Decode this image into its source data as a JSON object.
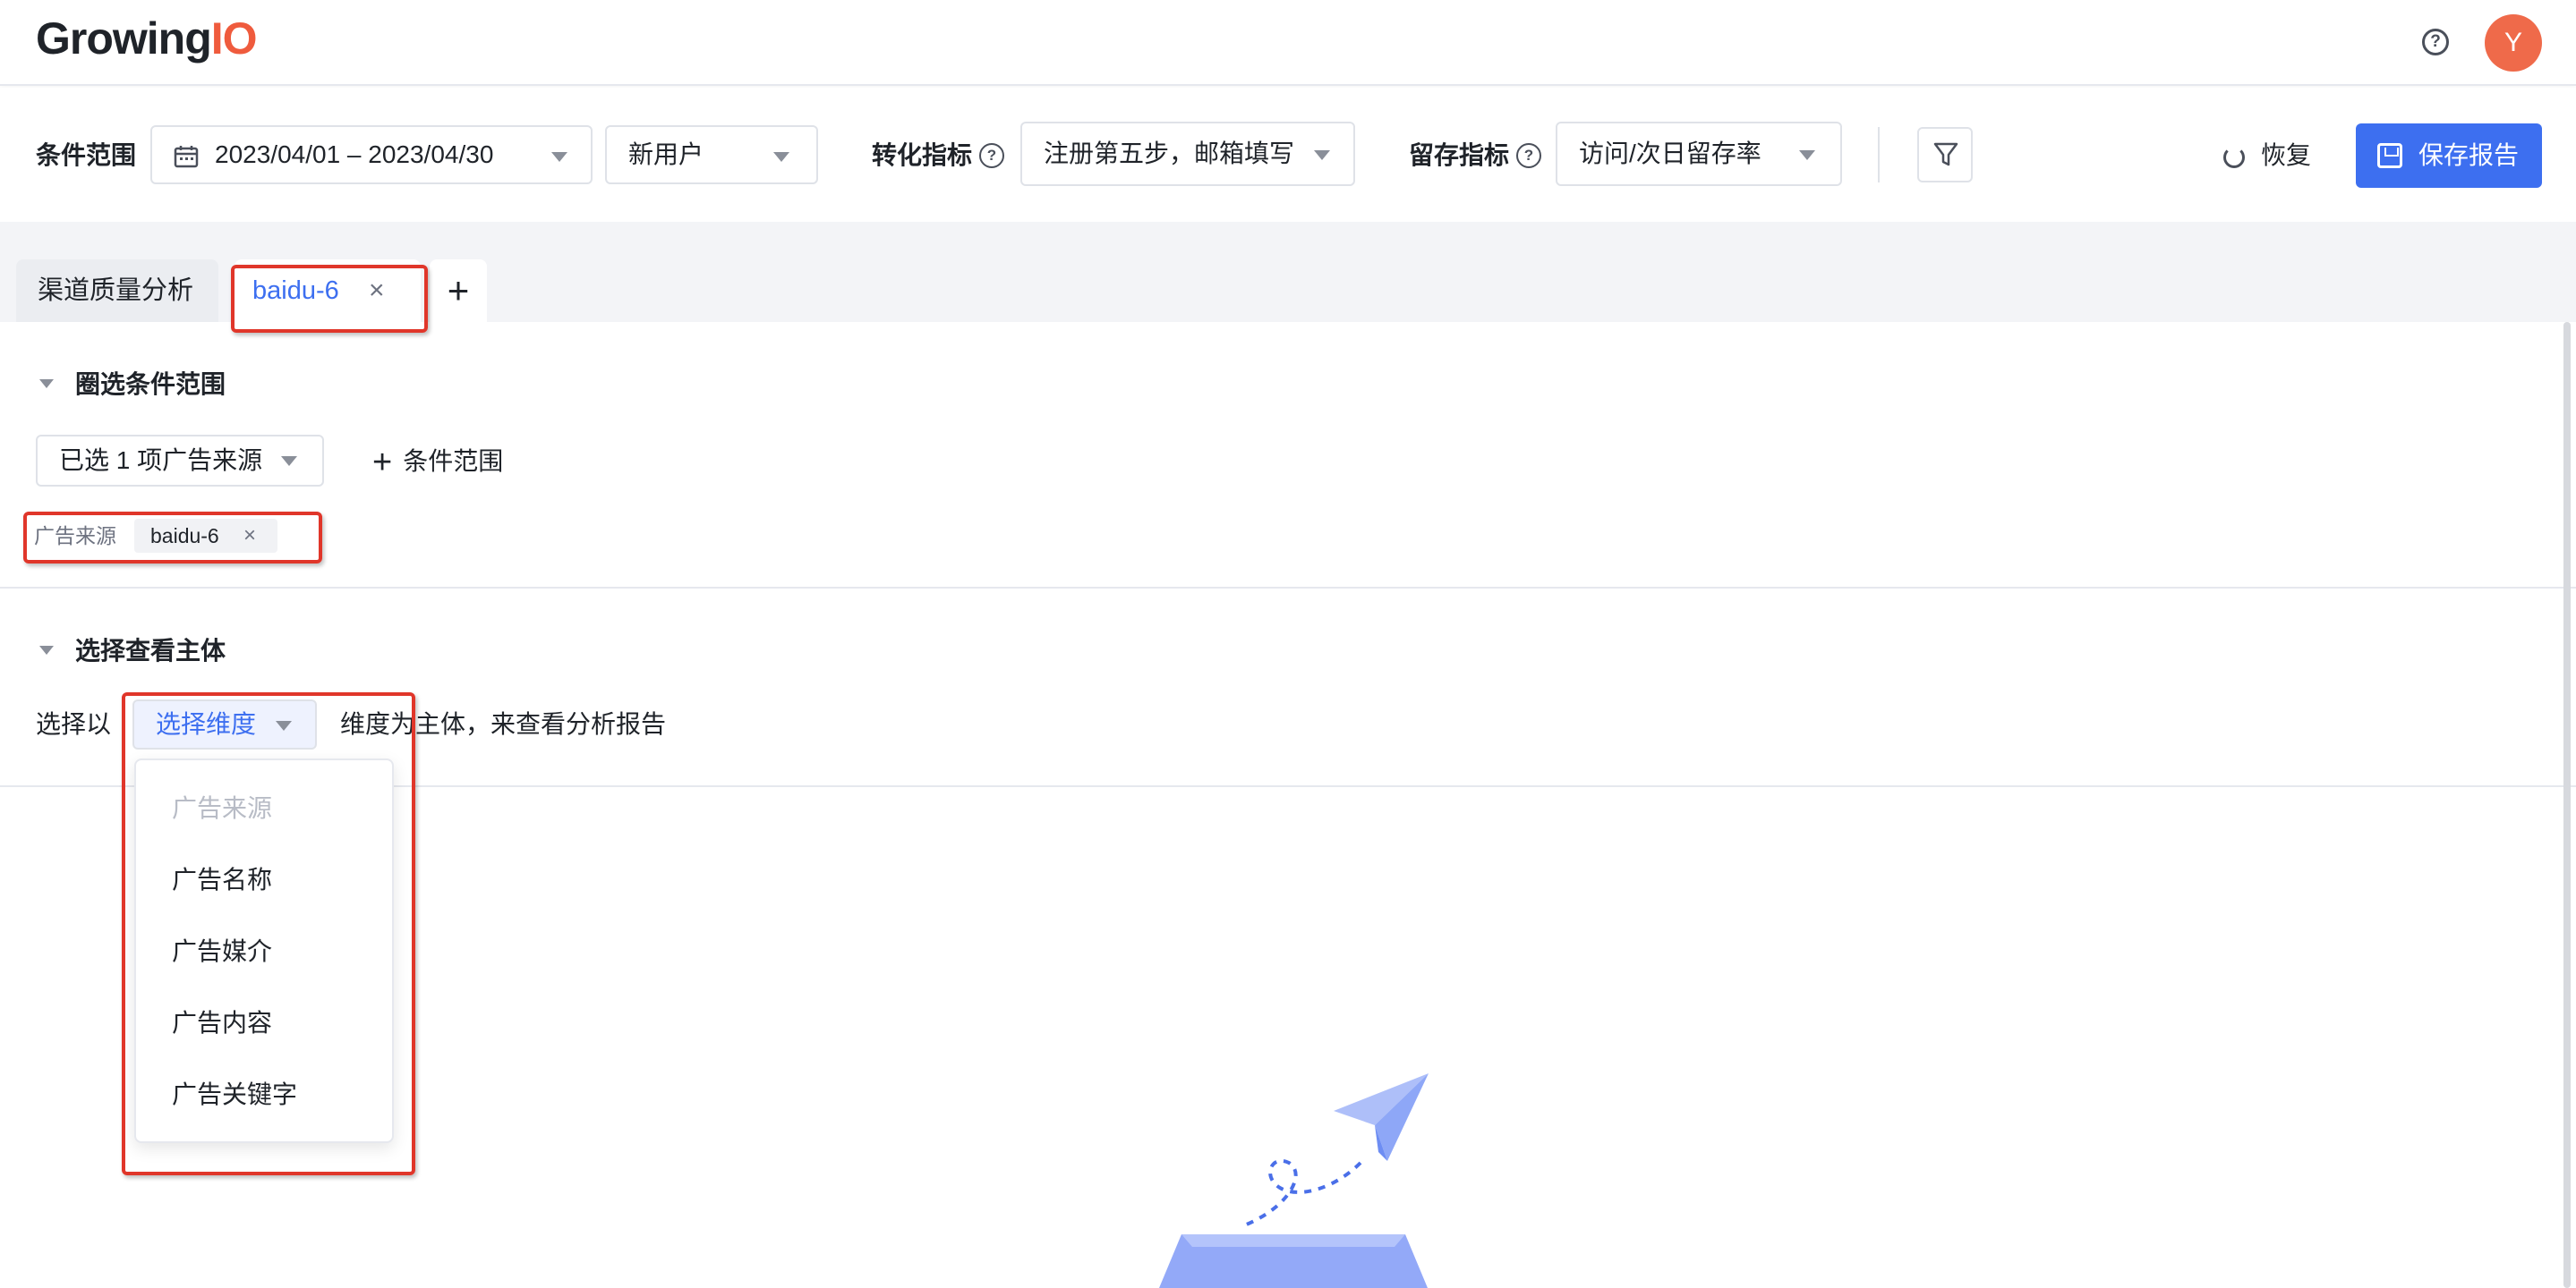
{
  "header": {
    "logo_main": "Growing",
    "logo_io": "IO",
    "help_label": "?",
    "avatar_initial": "Y"
  },
  "filters": {
    "condition_label": "条件范围",
    "date_range": "2023/04/01 – 2023/04/30",
    "user_type": "新用户",
    "conversion_label": "转化指标",
    "conversion_value": "注册第五步，邮箱填写",
    "retention_label": "留存指标",
    "retention_value": "访问/次日留存率",
    "help_glyph": "?"
  },
  "toolbar": {
    "restore_label": "恢复",
    "save_label": "保存报告"
  },
  "tabs": [
    {
      "label": "渠道质量分析",
      "active": false
    },
    {
      "label": "baidu-6",
      "active": true
    }
  ],
  "tab_close_glyph": "×",
  "tab_add_glyph": "+",
  "section1": {
    "title": "圈选条件范围",
    "selected_sources": "已选 1 项广告来源",
    "add_condition": "条件范围",
    "add_glyph": "+",
    "tag_key": "广告来源",
    "tag_value": "baidu-6",
    "tag_close": "×"
  },
  "section2": {
    "title": "选择查看主体",
    "prefix": "选择以",
    "dimension_placeholder": "选择维度",
    "suffix": "维度为主体，来查看分析报告",
    "options": [
      {
        "label": "广告来源",
        "disabled": true
      },
      {
        "label": "广告名称",
        "disabled": false
      },
      {
        "label": "广告媒介",
        "disabled": false
      },
      {
        "label": "广告内容",
        "disabled": false
      },
      {
        "label": "广告关键字",
        "disabled": false
      }
    ]
  },
  "colors": {
    "brand_primary": "#3d6ff0",
    "logo_accent": "#ef5b3d",
    "avatar_bg": "#ef6a4a",
    "annotation_red": "#e0362a"
  }
}
